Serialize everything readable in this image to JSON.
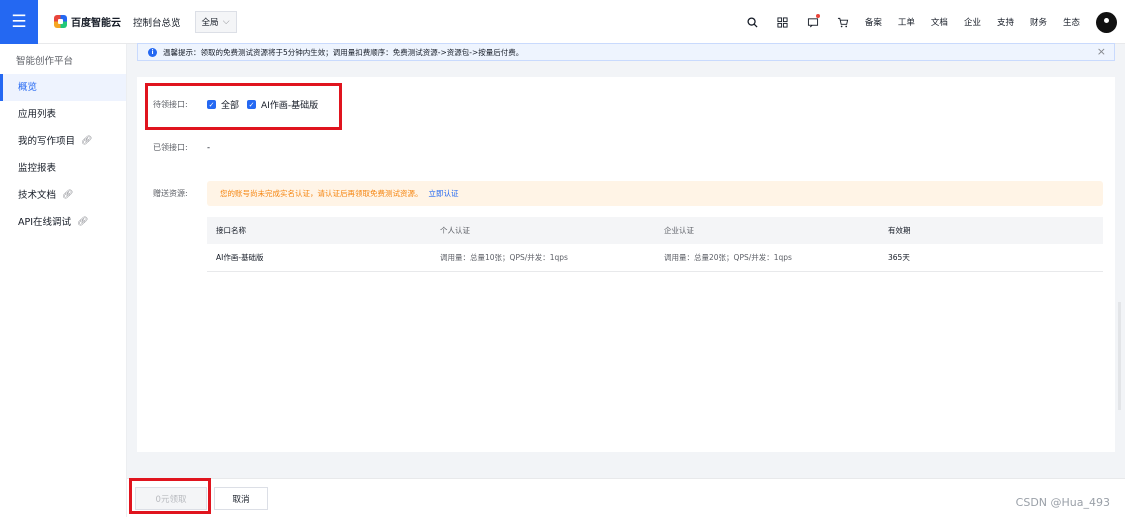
{
  "header": {
    "logo_text": "百度智能云",
    "console_link": "控制台总览",
    "region": "全局",
    "links": [
      "备案",
      "工单",
      "文档",
      "企业",
      "支持",
      "财务",
      "生态"
    ],
    "icons": [
      "search-icon",
      "grid-icon",
      "message-icon",
      "cart-icon"
    ]
  },
  "sidebar": {
    "title": "智能创作平台",
    "items": [
      {
        "label": "概览",
        "active": true,
        "external": false
      },
      {
        "label": "应用列表",
        "active": false,
        "external": false
      },
      {
        "label": "我的写作项目",
        "active": false,
        "external": true
      },
      {
        "label": "监控报表",
        "active": false,
        "external": false
      },
      {
        "label": "技术文档",
        "active": false,
        "external": true
      },
      {
        "label": "API在线调试",
        "active": false,
        "external": true
      }
    ]
  },
  "notice": {
    "text": "温馨提示：领取的免费测试资源将于5分钟内生效；调用量扣费顺序：免费测试资源->资源包->按量后付费。",
    "close": "×"
  },
  "form": {
    "pending_label": "待领接口:",
    "pending_options": [
      "全部",
      "AI作画-基础版"
    ],
    "received_label": "已领接口:",
    "received_value": "-",
    "gift_label": "赠送资源:",
    "warning_text": "您的账号尚未完成实名认证，请认证后再领取免费测试资源。",
    "warning_link": "立即认证"
  },
  "table": {
    "headers": [
      "接口名称",
      "个人认证",
      "企业认证",
      "有效期"
    ],
    "rows": [
      [
        "AI作画-基础版",
        "调用量：总量10张；QPS/并发：1qps",
        "调用量：总量20张；QPS/并发：1qps",
        "365天"
      ]
    ]
  },
  "footer": {
    "claim_button": "0元领取",
    "cancel_button": "取消",
    "watermark": "CSDN @Hua_493"
  },
  "colors": {
    "brand": "#2468f2",
    "highlight": "#e0141e",
    "warning_text": "#f5850f",
    "warning_bg": "#fff4e6"
  }
}
